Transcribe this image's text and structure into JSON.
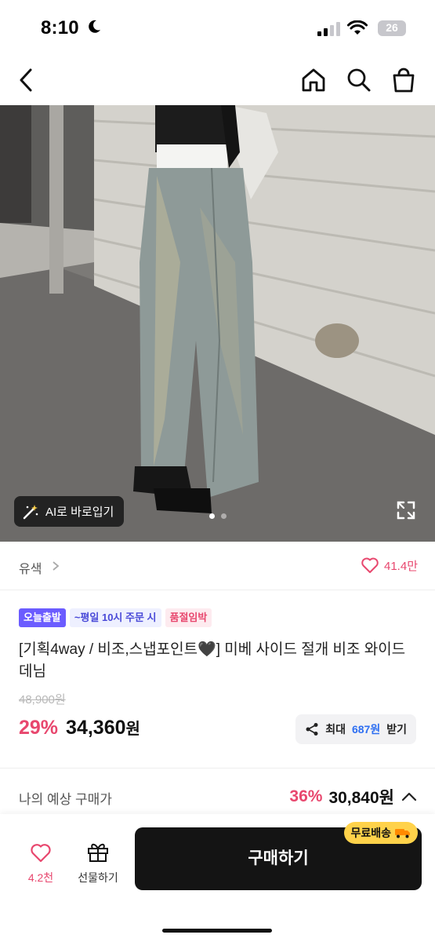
{
  "status_bar": {
    "time": "8:10",
    "battery": "26"
  },
  "nav": {
    "back": "chevron-left-icon",
    "home": "home-icon",
    "search": "search-icon",
    "bag": "shopping-bag-icon"
  },
  "hero": {
    "ai_button_label": "AI로 바로입기",
    "pages": 2,
    "active_page": 1
  },
  "color_row": {
    "label": "유색",
    "likes": "41.4만"
  },
  "badges": [
    "오늘출발",
    "~평일 10시 주문 시",
    "품절임박"
  ],
  "product": {
    "title": "[기획4way / 비조,스냅포인트🖤] 미베 사이드 절개 비조 와이드 데님",
    "original_price": "48,900원",
    "discount": "29%",
    "price": "34,360",
    "price_unit": "원"
  },
  "coupon": {
    "prefix": "최대",
    "amount": "687원",
    "suffix": "받기"
  },
  "estimate": {
    "label": "나의 예상 구매가",
    "discount": "36%",
    "price": "30,840원"
  },
  "bottom": {
    "like_count": "4.2천",
    "gift_label": "선물하기",
    "buy_label": "구매하기",
    "shipping_tag": "무료배송"
  },
  "colors": {
    "accent_pink": "#e8476e",
    "accent_blue": "#2e6ff2",
    "badge_purple": "#6b5cff",
    "buy_button": "#141414",
    "shipping_yellow": "#ffd24a"
  }
}
